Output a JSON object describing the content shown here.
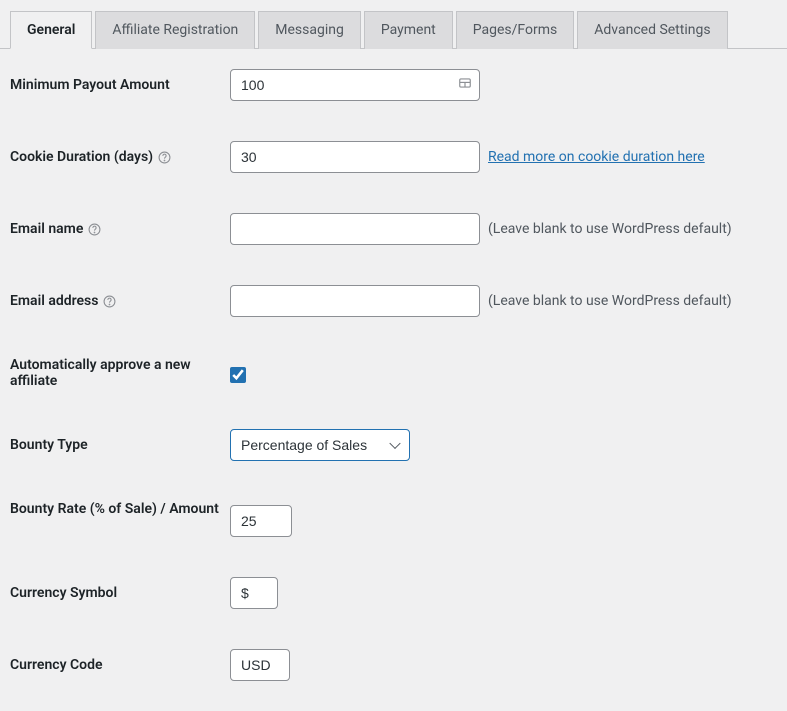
{
  "tabs": [
    {
      "label": "General",
      "active": true
    },
    {
      "label": "Affiliate Registration",
      "active": false
    },
    {
      "label": "Messaging",
      "active": false
    },
    {
      "label": "Payment",
      "active": false
    },
    {
      "label": "Pages/Forms",
      "active": false
    },
    {
      "label": "Advanced Settings",
      "active": false
    }
  ],
  "fields": {
    "min_payout": {
      "label": "Minimum Payout Amount",
      "value": "100"
    },
    "cookie_duration": {
      "label": "Cookie Duration (days)",
      "value": "30",
      "link_text": "Read more on cookie duration here"
    },
    "email_name": {
      "label": "Email name",
      "value": "",
      "hint": "(Leave blank to use WordPress default)"
    },
    "email_address": {
      "label": "Email address",
      "value": "",
      "hint": "(Leave blank to use WordPress default)"
    },
    "auto_approve": {
      "label": "Automatically approve a new affiliate",
      "checked": true
    },
    "bounty_type": {
      "label": "Bounty Type",
      "value": "Percentage of Sales"
    },
    "bounty_rate": {
      "label": "Bounty Rate (% of Sale) / Amount",
      "value": "25"
    },
    "currency_symbol": {
      "label": "Currency Symbol",
      "value": "$"
    },
    "currency_code": {
      "label": "Currency Code",
      "value": "USD"
    }
  }
}
